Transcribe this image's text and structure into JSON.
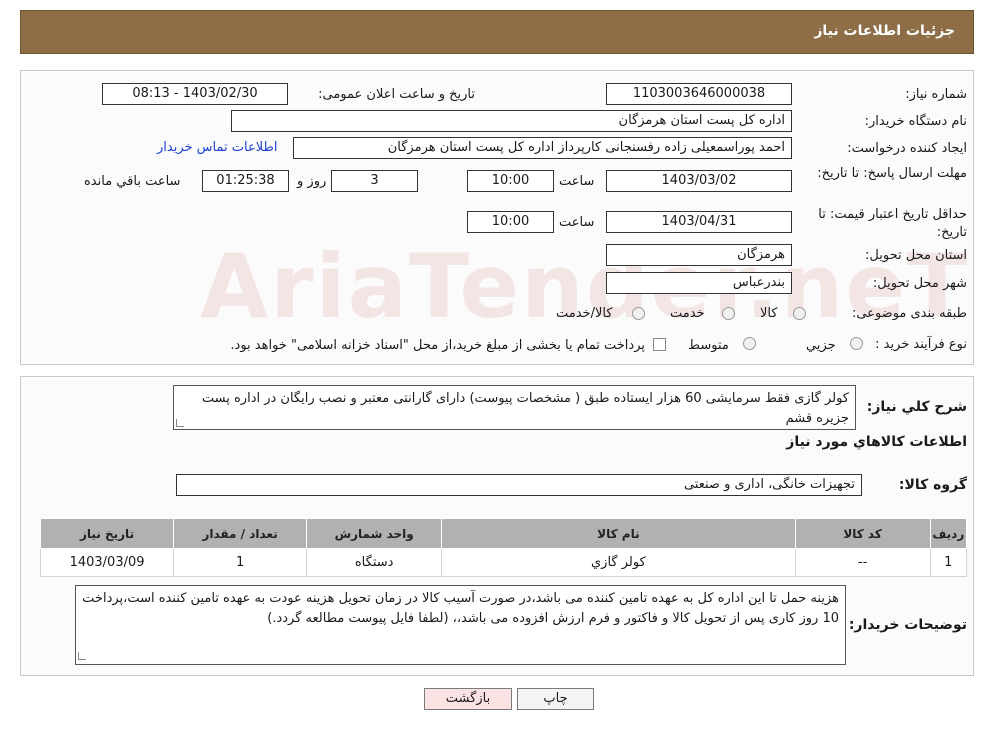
{
  "header": {
    "title": "جزئیات اطلاعات نیاز"
  },
  "fields": {
    "need_number_label": "شماره نیاز:",
    "need_number": "1103003646000038",
    "announce_label": "تاریخ و ساعت اعلان عمومی:",
    "announce_value": "1403/02/30 - 08:13",
    "buyer_org_label": "نام دستگاه خریدار:",
    "buyer_org": "اداره کل پست استان هرمزگان",
    "creator_label": "ایجاد کننده درخواست:",
    "creator": "احمد پوراسمعیلی زاده رفسنجانی کارپرداز اداره کل پست استان هرمزگان",
    "contact_link": "اطلاعات تماس خریدار",
    "reply_deadline_label": "مهلت ارسال پاسخ: تا تاریخ:",
    "reply_date": "1403/03/02",
    "time_label": "ساعت",
    "reply_time": "10:00",
    "days_value": "3",
    "days_label": "روز و",
    "remaining_time": "01:25:38",
    "remaining_label": "ساعت باقي مانده",
    "price_validity_label": "حداقل تاریخ اعتبار قیمت: تا تاریخ:",
    "price_date": "1403/04/31",
    "price_time": "10:00",
    "province_label": "استان محل تحویل:",
    "province": "هرمزگان",
    "city_label": "شهر محل تحویل:",
    "city": "بندرعباس",
    "category_label": "طبقه بندی موضوعی:",
    "category_options": [
      "کالا",
      "خدمت",
      "کالا/خدمت"
    ],
    "process_label": "نوع فرآیند خرید :",
    "process_options": [
      "جزیي",
      "متوسط"
    ],
    "process_note": "پرداخت تمام یا بخشی از مبلغ خرید،از محل \"اسناد خزانه اسلامی\" خواهد بود."
  },
  "watermark": "AriaTender.neT",
  "description": {
    "label": "شرح كلي نياز:",
    "text": "کولر گازی فقط سرمایشی 60 هزار ایستاده طبق ( مشخصات پیوست) دارای گارانتی معتبر و نصب رایگان در اداره پست جزیره قشم"
  },
  "goods": {
    "section_title": "اطلاعات كالاهاي مورد نياز",
    "group_label": "گروه کالا:",
    "group_value": "تجهیزات خانگی، اداری و صنعتی",
    "columns": [
      "رديف",
      "كد كالا",
      "نام كالا",
      "واحد شمارش",
      "تعداد / مقدار",
      "تاریخ نیاز"
    ],
    "rows": [
      [
        "1",
        "--",
        "كولر گازي",
        "دستگاه",
        "1",
        "1403/03/09"
      ]
    ]
  },
  "buyer_notes": {
    "label": "توضیحات خریدار:",
    "text": "هزینه حمل تا این اداره کل به عهده تامین کننده می باشد،در صورت  آسیب کالا در زمان تحویل هزینه عودت به عهده تامین کننده است،پرداخت 10 روز کاری پس از تحویل کالا و فاکتور و فرم ارزش افزوده می باشد،، (لطفا فایل پیوست مطالعه گردد.)"
  },
  "buttons": {
    "print": "چاپ",
    "back": "بازگشت"
  }
}
